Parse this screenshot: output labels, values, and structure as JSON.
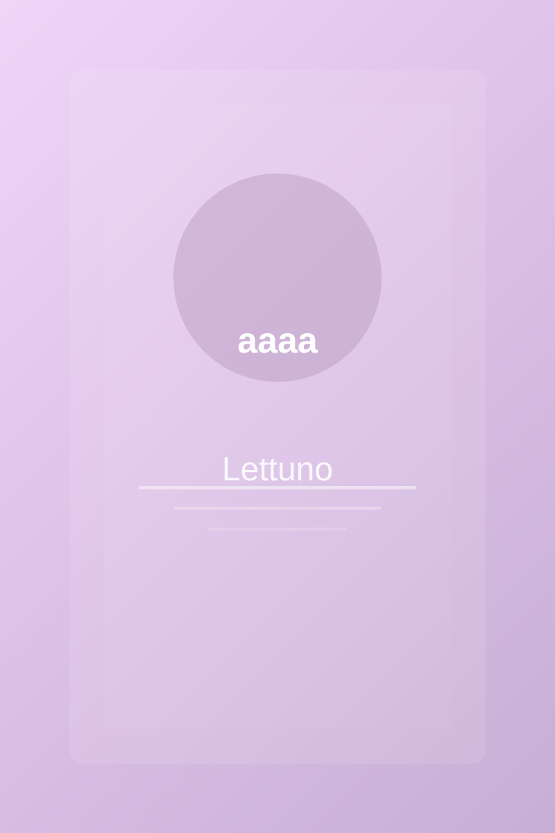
{
  "profile": {
    "avatar_text": "aaaa",
    "name": "Lettuno"
  },
  "colors": {
    "background_start": "#efd6f9",
    "background_end": "#c6aed4",
    "text": "#ffffff"
  },
  "icons": {
    "avatar": "avatar-circle"
  }
}
